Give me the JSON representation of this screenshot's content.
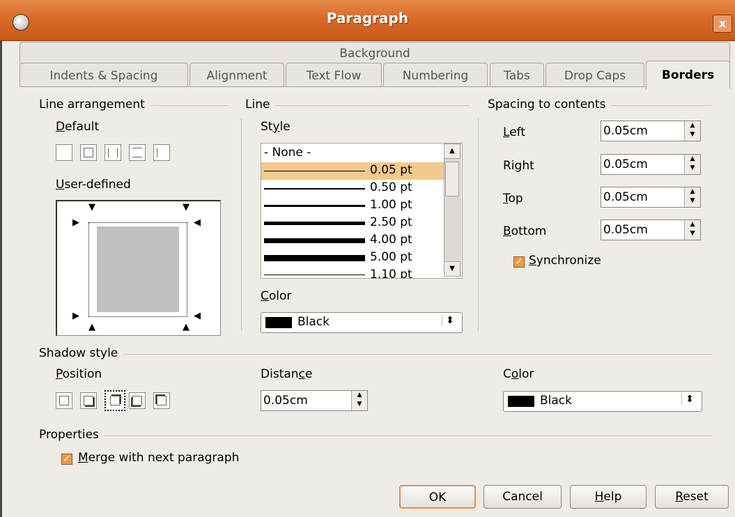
{
  "window": {
    "title": "Paragraph",
    "close_glyph": "x"
  },
  "tabs": {
    "background": "Background",
    "items": [
      "Indents & Spacing",
      "Alignment",
      "Text Flow",
      "Numbering",
      "Tabs",
      "Drop Caps",
      "Borders"
    ],
    "active": "Borders"
  },
  "line_arrangement": {
    "heading": "Line arrangement",
    "default_label": "Default",
    "user_defined_label": "User-defined"
  },
  "line": {
    "heading": "Line",
    "style_label": "Style",
    "styles": [
      "- None -",
      "0.05 pt",
      "0.50 pt",
      "1.00 pt",
      "2.50 pt",
      "4.00 pt",
      "5.00 pt",
      "1.10 pt"
    ],
    "selected_style": "0.05 pt",
    "color_label": "Color",
    "color_value": "Black",
    "color_hex": "#000000"
  },
  "spacing": {
    "heading": "Spacing to contents",
    "left_label": "Left",
    "left_value": "0.05cm",
    "right_label": "Right",
    "right_value": "0.05cm",
    "top_label": "Top",
    "top_value": "0.05cm",
    "bottom_label": "Bottom",
    "bottom_value": "0.05cm",
    "synchronize_label": "Synchronize",
    "synchronize_checked": true
  },
  "shadow": {
    "heading": "Shadow style",
    "position_label": "Position",
    "distance_label": "Distance",
    "distance_value": "0.05cm",
    "color_label": "Color",
    "color_value": "Black"
  },
  "properties": {
    "heading": "Properties",
    "merge_label": "Merge with next paragraph",
    "merge_checked": true
  },
  "buttons": {
    "ok": "OK",
    "cancel": "Cancel",
    "help": "Help",
    "reset": "Reset"
  },
  "colors": {
    "titlebar": "#d96a26",
    "selection": "#f4c98f",
    "accent": "#f39a3c"
  }
}
